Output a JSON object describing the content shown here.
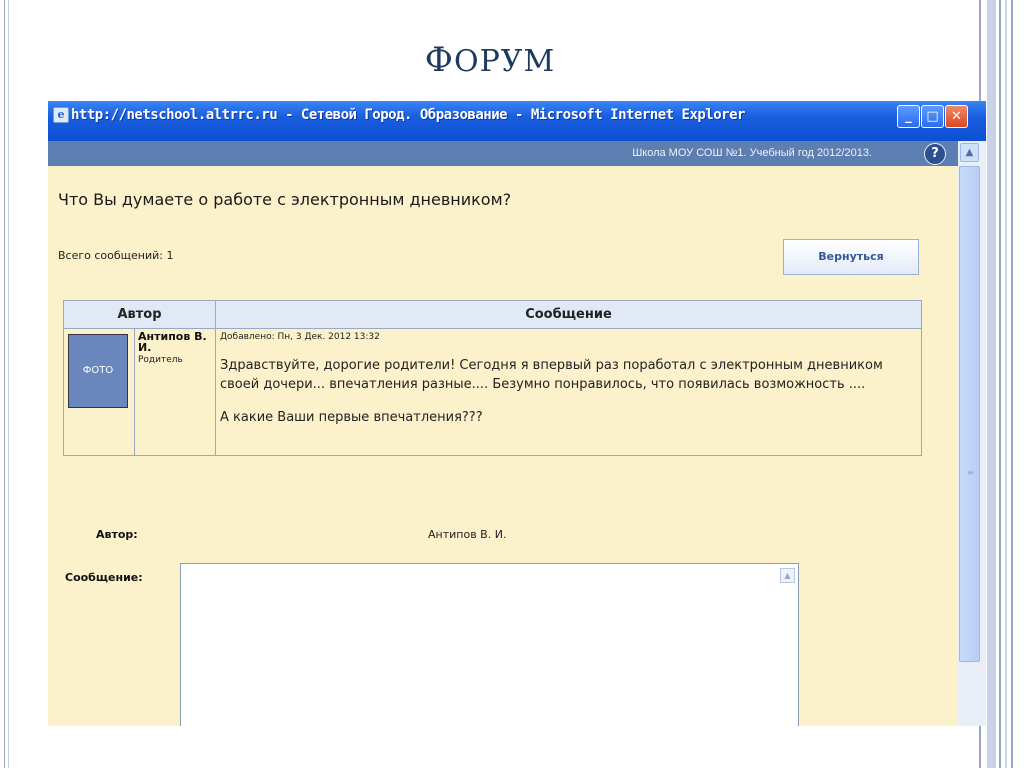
{
  "slide": {
    "title_cap": "Ф",
    "title_rest": "ОРУМ"
  },
  "window": {
    "title": "http://netschool.altrrc.ru - Сетевой Город. Образование - Microsoft Internet Explorer",
    "minimize": "_",
    "maximize": "□",
    "close": "✕"
  },
  "infobar": {
    "school": "Школа МОУ СОШ №1. Учебный год 2012/2013.",
    "help": "?"
  },
  "topic": {
    "title": "Что Вы думаете о работе с электронным дневником?",
    "total_label": "Всего сообщений: 1",
    "back_button": "Вернуться"
  },
  "table": {
    "headers": [
      "Автор",
      "Сообщение"
    ],
    "rows": [
      {
        "photo": "ФОТО",
        "author": "Антипов В. И.",
        "role": "Родитель",
        "date": "Добавлено: Пн, 3 Дек. 2012 13:32",
        "paragraph1": "Здравствуйте, дорогие родители! Сегодня я впервый раз поработал с электронным дневником своей дочери... впечатления разные.... Безумно понравилось, что появилась возможность ....",
        "paragraph2": "А какие Ваши первые впечатления???"
      }
    ]
  },
  "form": {
    "author_label": "Автор:",
    "author_value": "Антипов В. И.",
    "message_label": "Сообщение:",
    "message_value": ""
  },
  "icons": {
    "scroll_up": "▲",
    "grip": "≡",
    "ie": "e"
  }
}
